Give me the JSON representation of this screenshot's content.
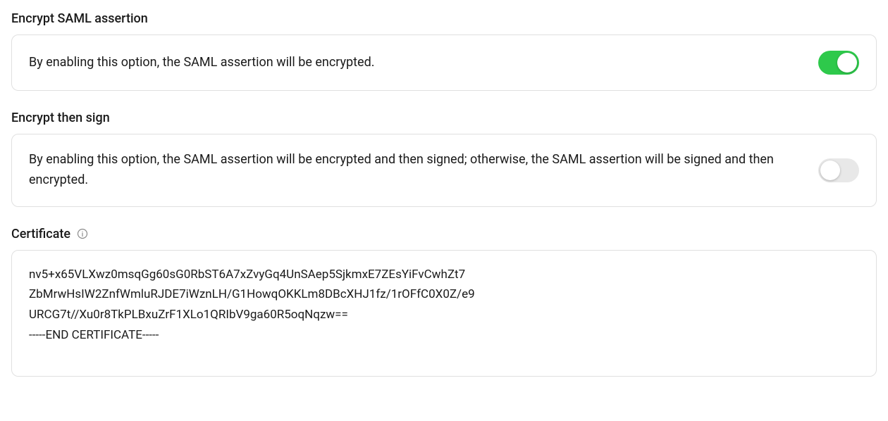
{
  "encryptAssertion": {
    "title": "Encrypt SAML assertion",
    "description": "By enabling this option, the SAML assertion will be encrypted.",
    "enabled": true
  },
  "encryptThenSign": {
    "title": "Encrypt then sign",
    "description": "By enabling this option, the SAML assertion will be encrypted and then signed; otherwise, the SAML assertion will be signed and then encrypted.",
    "enabled": false
  },
  "certificate": {
    "title": "Certificate",
    "value": "nv5+x65VLXwz0msqGg60sG0RbST6A7xZvyGq4UnSAep5SjkmxE7ZEsYiFvCwhZt7\nZbMrwHsIW2ZnfWmluRJDE7iWznLH/G1HowqOKKLm8DBcXHJ1fz/1rOFfC0X0Z/e9\nURCG7t//Xu0r8TkPLBxuZrF1XLo1QRIbV9ga60R5oqNqzw==\n-----END CERTIFICATE-----"
  }
}
